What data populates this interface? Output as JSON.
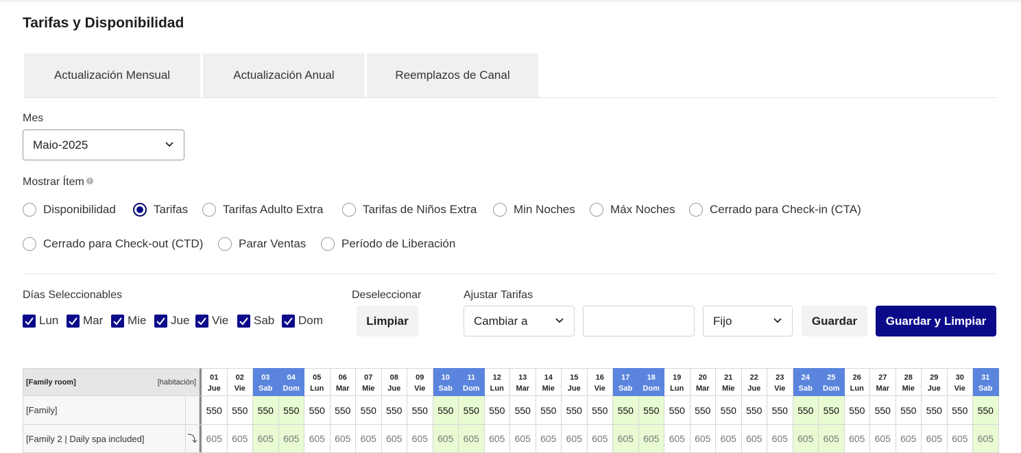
{
  "page": {
    "title": "Tarifas y Disponibilidad"
  },
  "tabs": [
    {
      "label": "Actualización Mensual"
    },
    {
      "label": "Actualización Anual"
    },
    {
      "label": "Reemplazos de Canal"
    }
  ],
  "month": {
    "label": "Mes",
    "value": "Maio-2025"
  },
  "show_item": {
    "label": "Mostrar Ítem",
    "options": [
      {
        "label": "Disponibilidad",
        "selected": false
      },
      {
        "label": "Tarifas",
        "selected": true
      },
      {
        "label": "Tarifas Adulto Extra",
        "selected": false
      },
      {
        "label": "Tarifas de Niños Extra",
        "selected": false
      },
      {
        "label": "Min Noches",
        "selected": false
      },
      {
        "label": "Máx Noches",
        "selected": false
      },
      {
        "label": "Cerrado para Check-in (CTA)",
        "selected": false
      },
      {
        "label": "Cerrado para Check-out (CTD)",
        "selected": false
      },
      {
        "label": "Parar Ventas",
        "selected": false
      },
      {
        "label": "Período de Liberación",
        "selected": false
      }
    ]
  },
  "days": {
    "label": "Días Seleccionables",
    "items": [
      {
        "label": "Lun",
        "checked": true
      },
      {
        "label": "Mar",
        "checked": true
      },
      {
        "label": "Mie",
        "checked": true
      },
      {
        "label": "Jue",
        "checked": true
      },
      {
        "label": "Vie",
        "checked": true
      },
      {
        "label": "Sab",
        "checked": true
      },
      {
        "label": "Dom",
        "checked": true
      }
    ]
  },
  "deselect": {
    "label": "Deseleccionar",
    "button": "Limpiar"
  },
  "adjust": {
    "label": "Ajustar Tarifas",
    "mode_value": "Cambiar a",
    "amount_value": "",
    "type_value": "Fijo",
    "save_button": "Guardar",
    "save_clear_button": "Guardar y Limpiar"
  },
  "colors": {
    "primary": "#0b0b8a",
    "weekend_header": "#5b85dd",
    "weekend_cell": "#e8fbd3"
  },
  "grid": {
    "room_name": "[Family room]",
    "room_unit": "[habitación]",
    "dates": [
      {
        "d": "01",
        "w": "Jue",
        "we": false
      },
      {
        "d": "02",
        "w": "Vie",
        "we": false
      },
      {
        "d": "03",
        "w": "Sab",
        "we": true
      },
      {
        "d": "04",
        "w": "Dom",
        "we": true
      },
      {
        "d": "05",
        "w": "Lun",
        "we": false
      },
      {
        "d": "06",
        "w": "Mar",
        "we": false
      },
      {
        "d": "07",
        "w": "Mie",
        "we": false
      },
      {
        "d": "08",
        "w": "Jue",
        "we": false
      },
      {
        "d": "09",
        "w": "Vie",
        "we": false
      },
      {
        "d": "10",
        "w": "Sab",
        "we": true
      },
      {
        "d": "11",
        "w": "Dom",
        "we": true
      },
      {
        "d": "12",
        "w": "Lun",
        "we": false
      },
      {
        "d": "13",
        "w": "Mar",
        "we": false
      },
      {
        "d": "14",
        "w": "Mie",
        "we": false
      },
      {
        "d": "15",
        "w": "Jue",
        "we": false
      },
      {
        "d": "16",
        "w": "Vie",
        "we": false
      },
      {
        "d": "17",
        "w": "Sab",
        "we": true
      },
      {
        "d": "18",
        "w": "Dom",
        "we": true
      },
      {
        "d": "19",
        "w": "Lun",
        "we": false
      },
      {
        "d": "20",
        "w": "Mar",
        "we": false
      },
      {
        "d": "21",
        "w": "Mie",
        "we": false
      },
      {
        "d": "22",
        "w": "Jue",
        "we": false
      },
      {
        "d": "23",
        "w": "Vie",
        "we": false
      },
      {
        "d": "24",
        "w": "Sab",
        "we": true
      },
      {
        "d": "25",
        "w": "Dom",
        "we": true
      },
      {
        "d": "26",
        "w": "Lun",
        "we": false
      },
      {
        "d": "27",
        "w": "Mar",
        "we": false
      },
      {
        "d": "28",
        "w": "Mie",
        "we": false
      },
      {
        "d": "29",
        "w": "Jue",
        "we": false
      },
      {
        "d": "30",
        "w": "Vie",
        "we": false
      },
      {
        "d": "31",
        "w": "Sab",
        "we": true
      }
    ],
    "rates": [
      {
        "name": "[Family]",
        "icon": "",
        "value": "550"
      },
      {
        "name": "[Family 2 | Daily spa included]",
        "icon": "arrow-down-icon",
        "value": "605"
      }
    ]
  }
}
